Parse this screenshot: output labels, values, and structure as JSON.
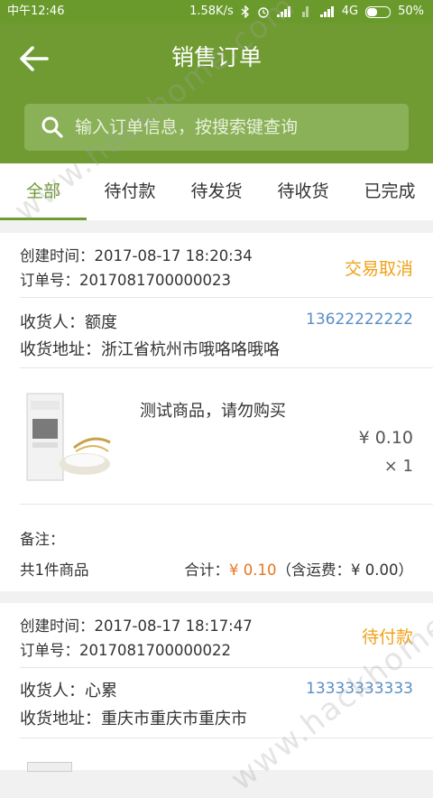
{
  "status_bar": {
    "time": "中午12:46",
    "speed": "1.58K/s",
    "network": "4G",
    "battery": "50%"
  },
  "header": {
    "title": "销售订单",
    "search_placeholder": "输入订单信息，按搜索键查询"
  },
  "tabs": [
    {
      "label": "全部",
      "active": true
    },
    {
      "label": "待付款"
    },
    {
      "label": "待发货"
    },
    {
      "label": "待收货"
    },
    {
      "label": "已完成"
    }
  ],
  "orders": [
    {
      "created": "创建时间：2017-08-17 18:20:34",
      "order_no": "订单号：2017081700000023",
      "status": "交易取消",
      "receiver": "收货人：额度",
      "phone": "13622222222",
      "address": "收货地址：浙江省杭州市哦咯咯哦咯",
      "product_name": "测试商品，请勿购买",
      "price": "¥ 0.10",
      "qty": "× 1",
      "remark": "备注：",
      "count": "共1件商品",
      "total_label": "合计：",
      "total_value": "¥ 0.10",
      "shipping": "（含运费：¥ 0.00）"
    },
    {
      "created": "创建时间：2017-08-17 18:17:47",
      "order_no": "订单号：2017081700000022",
      "status": "待付款",
      "receiver": "收货人：心累",
      "phone": "13333333333",
      "address": "收货地址：重庆市重庆市重庆市"
    }
  ],
  "watermark": "www.hackhome.com",
  "colors": {
    "brand_green": "#6f9b32",
    "status_orange": "#f0a21a",
    "phone_blue": "#5a8ec4",
    "price_orange": "#e8741e"
  }
}
